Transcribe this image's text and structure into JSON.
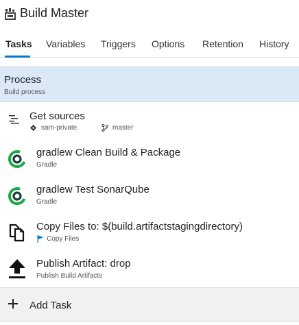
{
  "header": {
    "title": "Build Master",
    "icon": "build-definition-icon"
  },
  "tabs": [
    {
      "label": "Tasks",
      "active": true
    },
    {
      "label": "Variables",
      "active": false
    },
    {
      "label": "Triggers",
      "active": false
    },
    {
      "label": "Options",
      "active": false
    },
    {
      "label": "Retention",
      "active": false
    },
    {
      "label": "History",
      "active": false
    }
  ],
  "process": {
    "title": "Process",
    "subtitle": "Build process"
  },
  "get_sources": {
    "title": "Get sources",
    "repo": "sam-private",
    "branch": "master",
    "icon": "list-icon"
  },
  "tasks": [
    {
      "title": "gradlew Clean Build & Package",
      "subtitle": "Gradle",
      "icon": "gradle-icon"
    },
    {
      "title": "gradlew Test SonarQube",
      "subtitle": "Gradle",
      "icon": "gradle-icon"
    },
    {
      "title": "Copy Files to: $(build.artifactstagingdirectory)",
      "subtitle": "Copy Files",
      "icon": "copy-files-icon"
    },
    {
      "title": "Publish Artifact: drop",
      "subtitle": "Publish Build Artifacts",
      "icon": "upload-icon"
    }
  ],
  "add_task": {
    "label": "Add Task"
  },
  "colors": {
    "accent": "#0078d7",
    "process_bg": "#dbe9f6",
    "gradle_green": "#1ba946",
    "gradle_dark": "#1d3a3a"
  }
}
